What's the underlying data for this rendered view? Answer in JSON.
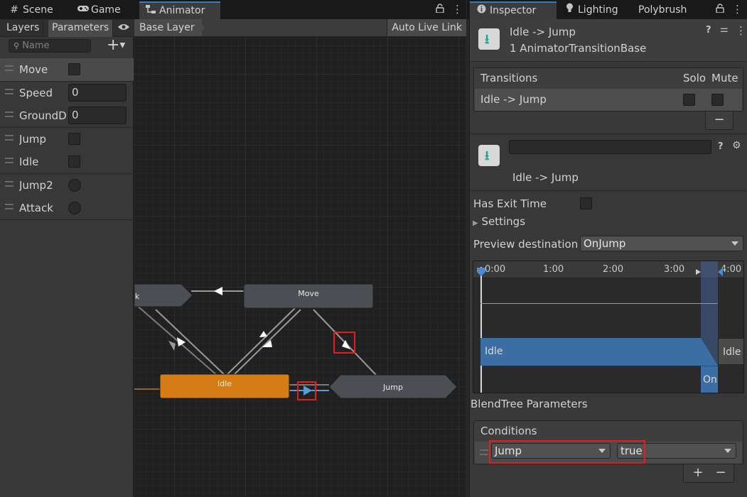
{
  "left_tabs": [
    {
      "label": "Scene",
      "icon": "hash-icon"
    },
    {
      "label": "Game",
      "icon": "gamepad-icon"
    },
    {
      "label": "Animator",
      "icon": "animator-icon"
    }
  ],
  "right_tabs": [
    {
      "label": "Inspector",
      "icon": "info-icon"
    },
    {
      "label": "Lighting",
      "icon": "bulb-icon"
    },
    {
      "label": "Polybrush"
    }
  ],
  "params_toolbar": {
    "layers": "Layers",
    "parameters": "Parameters",
    "search_placeholder": "Name"
  },
  "parameters": [
    {
      "name": "Move",
      "type": "bool"
    },
    {
      "name": "Speed",
      "type": "float",
      "value": "0"
    },
    {
      "name": "GroundDi",
      "type": "float",
      "value": "0"
    },
    {
      "name": "Jump",
      "type": "bool"
    },
    {
      "name": "Idle",
      "type": "bool"
    },
    {
      "name": "Jump2",
      "type": "trigger"
    },
    {
      "name": "Attack",
      "type": "trigger"
    }
  ],
  "graph": {
    "breadcrumb": "Base Layer",
    "live_link": "Auto Live Link",
    "states": {
      "move": "Move",
      "idle": "Idle",
      "jump": "Jump",
      "left": "k"
    },
    "colors": {
      "default_state": "#4b4e52",
      "default_layer_state": "#d57d14",
      "transition": "#9a9a9a",
      "selected_transition": "#5a9be0"
    }
  },
  "inspector": {
    "title": "Idle -> Jump",
    "subtitle": "1 AnimatorTransitionBase",
    "transitions_header": {
      "label": "Transitions",
      "solo": "Solo",
      "mute": "Mute"
    },
    "transition_row": "Idle -> Jump",
    "remove_symbol": "−",
    "add_symbol": "+",
    "name_field_value": "",
    "transition_label": "Idle -> Jump",
    "has_exit_time_label": "Has Exit Time",
    "settings_label": "Settings",
    "preview_label": "Preview destination :",
    "preview_value": "OnJump",
    "timeline": {
      "ticks": [
        "0:00",
        "1:00",
        "2:00",
        "3:00",
        "4:00"
      ],
      "source_bar": "Idle",
      "source_bar_tail": "Idle",
      "dest_bar": "On."
    },
    "blendtree_label": "BlendTree Parameters",
    "conditions_header": "Conditions",
    "condition": {
      "parameter": "Jump",
      "value": "true"
    }
  }
}
